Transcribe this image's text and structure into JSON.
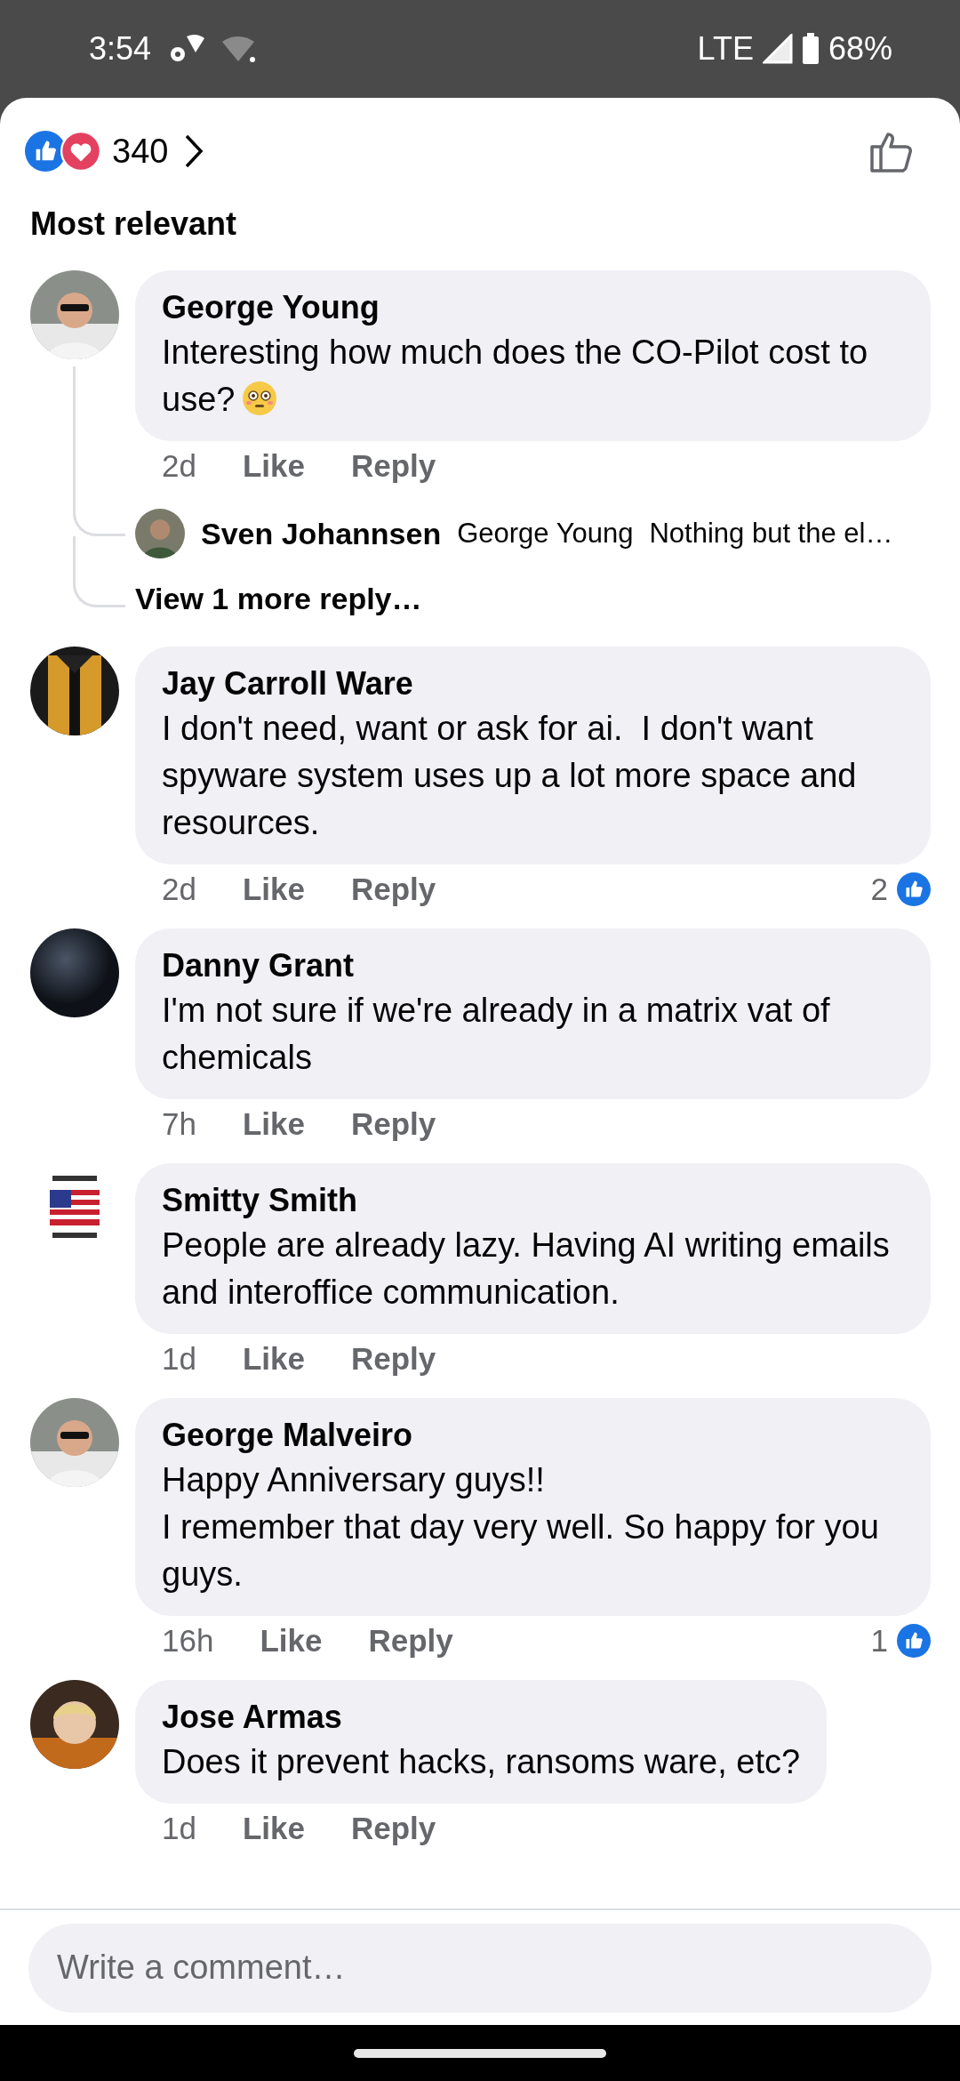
{
  "status_bar": {
    "time": "3:54",
    "network": "LTE",
    "battery": "68%"
  },
  "reactions": {
    "count": "340"
  },
  "sort_label": "Most relevant",
  "comments": [
    {
      "author": "George Young",
      "text": "Interesting how much does the CO-Pilot cost to use?",
      "has_emoji": true,
      "time": "2d",
      "like": "Like",
      "reply": "Reply",
      "replies": [
        {
          "author": "Sven Johannsen",
          "mention": "George Young",
          "text": "Nothing but the el…"
        }
      ],
      "more_replies": "View 1 more reply…"
    },
    {
      "author": "Jay Carroll Ware",
      "text": "I don't need, want or ask for ai.  I don't want spyware system uses up a lot more space and resources.",
      "time": "2d",
      "like": "Like",
      "reply": "Reply",
      "likes": "2"
    },
    {
      "author": "Danny Grant",
      "text": "I'm not sure if we're already in a matrix vat of chemicals",
      "time": "7h",
      "like": "Like",
      "reply": "Reply"
    },
    {
      "author": "Smitty Smith",
      "text": "People are already lazy. Having AI writing emails and interoffice communication.",
      "time": "1d",
      "like": "Like",
      "reply": "Reply"
    },
    {
      "author": "George Malveiro",
      "text": "Happy Anniversary guys!!\nI remember that day very well. So happy for you guys.",
      "time": "16h",
      "like": "Like",
      "reply": "Reply",
      "likes": "1"
    },
    {
      "author": "Jose Armas",
      "text": "Does it prevent hacks, ransoms ware, etc?",
      "time": "1d",
      "like": "Like",
      "reply": "Reply"
    }
  ],
  "composer": {
    "placeholder": "Write a comment…"
  }
}
